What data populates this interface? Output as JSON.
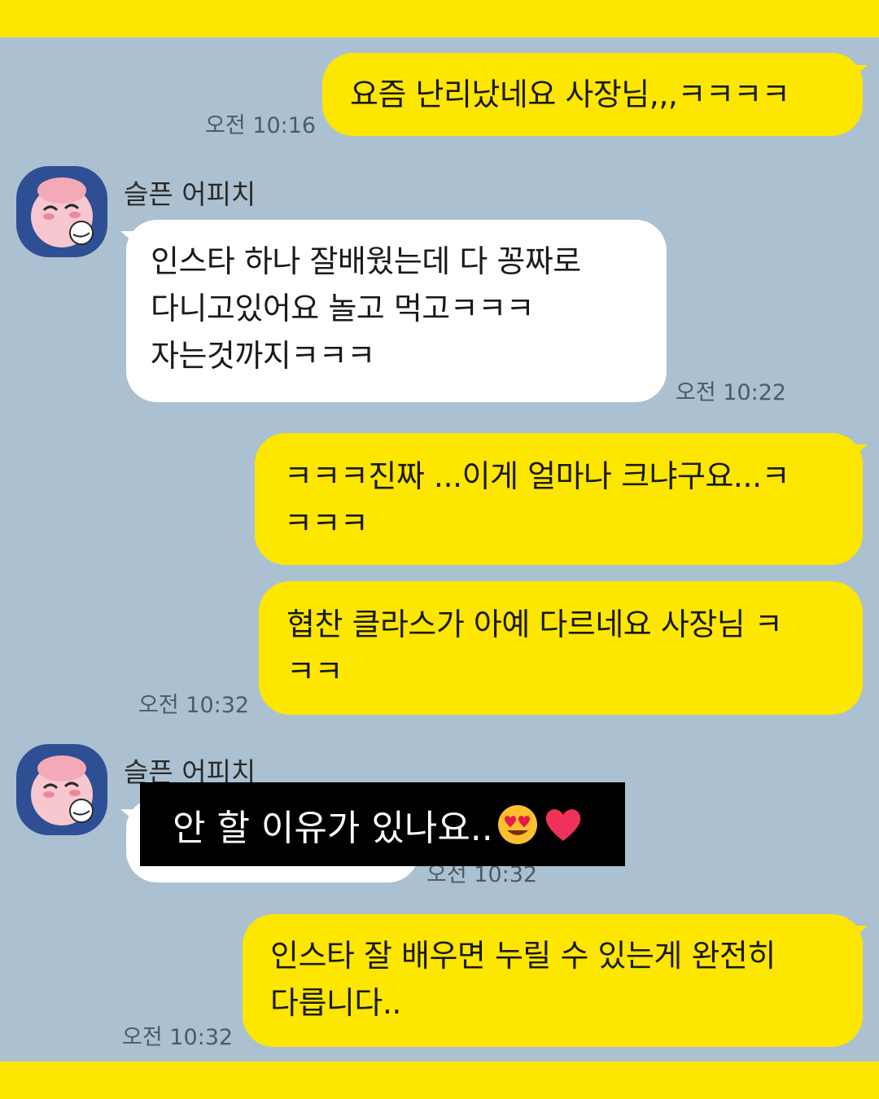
{
  "messages": [
    {
      "side": "me",
      "text": "요즘 난리났네요 사장님,,,ㅋㅋㅋㅋ",
      "time": "오전 10:16"
    },
    {
      "side": "other",
      "sender": "슬픈 어피치",
      "lines": [
        "인스타 하나 잘배웠는데 다 꽁짜로",
        "다니고있어요 놀고 먹고ㅋㅋㅋ",
        "자는것까지ㅋㅋㅋ"
      ],
      "time": "오전 10:22"
    },
    {
      "side": "me",
      "lines": [
        "ㅋㅋㅋ진짜 ...이게 얼마나 크냐구요...ㅋ",
        "ㅋㅋㅋ"
      ]
    },
    {
      "side": "me",
      "lines": [
        "협찬 클라스가 아예 다르네요 사장님 ㅋ",
        "ㅋㅋ"
      ],
      "time": "오전 10:32"
    },
    {
      "side": "other",
      "sender": "슬픈 어피치",
      "time": "오전 10:32"
    },
    {
      "side": "me",
      "lines": [
        "인스타 잘 배우면 누릴 수 있는게 완전히",
        "다릅니다.."
      ],
      "time": "오전 10:32"
    }
  ],
  "caption": {
    "text": "안 할 이유가 있나요..",
    "emoji": [
      "heart-eyes-emoji",
      "red-heart-emoji"
    ]
  },
  "colors": {
    "background": "#abc1d1",
    "my_bubble": "#fde600",
    "other_bubble": "#ffffff",
    "frame": "#fde600"
  }
}
